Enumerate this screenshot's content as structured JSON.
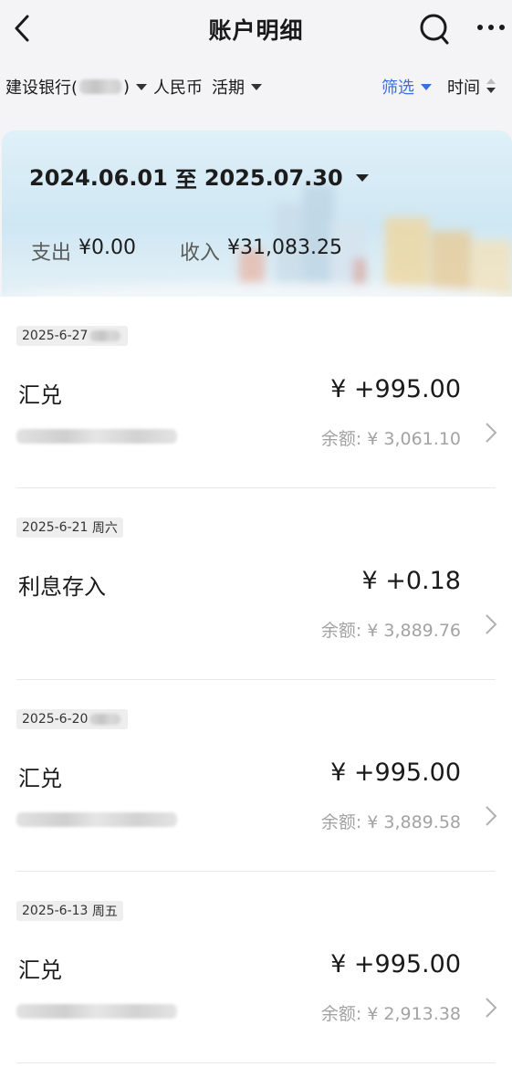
{
  "header": {
    "title": "账户明细",
    "back_icon": "chevron-left-icon",
    "search_icon": "search-icon",
    "more_icon": "more-horizontal-icon"
  },
  "filter_bar": {
    "bank_label": "建设银行(",
    "bank_suffix": ")",
    "currency": "人民币",
    "account_type": "活期",
    "filter_label": "筛选",
    "time_label": "时间",
    "accent_color": "#3b6ee0"
  },
  "summary": {
    "date_from": "2024.06.01",
    "date_sep": "至",
    "date_to": "2025.07.30",
    "expense_label": "支出",
    "expense_value": "¥0.00",
    "income_label": "收入",
    "income_value": "¥31,083.25"
  },
  "transactions": [
    {
      "date": "2025-6-27",
      "weekday": "",
      "title": "汇兑",
      "amount": "¥ +995.00",
      "balance": "余额: ¥ 3,061.10"
    },
    {
      "date": "2025-6-21",
      "weekday": "周六",
      "title": "利息存入",
      "amount": "¥ +0.18",
      "balance": "余额: ¥ 3,889.76"
    },
    {
      "date": "2025-6-20",
      "weekday": "",
      "title": "汇兑",
      "amount": "¥ +995.00",
      "balance": "余额: ¥ 3,889.58"
    },
    {
      "date": "2025-6-13",
      "weekday": "周五",
      "title": "汇兑",
      "amount": "¥ +995.00",
      "balance": "余额: ¥ 2,913.38"
    }
  ]
}
